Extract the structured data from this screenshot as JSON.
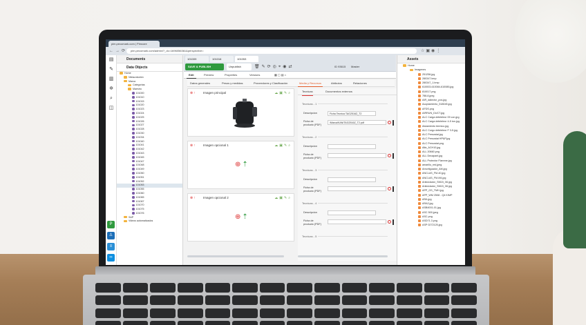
{
  "browser": {
    "tab_title": "pim.pecomark.com | Pimcore",
    "url": "pim.pecomark.com/admin/?_dc=1696056361&perspective="
  },
  "left_rail": {
    "icons": [
      "file-icon",
      "wrench-icon",
      "chart-icon",
      "gear-icon",
      "search-icon",
      "layers-icon"
    ]
  },
  "tree": {
    "documents_label": "Documents",
    "data_objects_label": "Data Objects",
    "items": [
      {
        "label": "Home",
        "type": "folder",
        "indent": 0
      },
      {
        "label": "Ntesuraturión",
        "type": "folder",
        "indent": 1
      },
      {
        "label": "Marca",
        "type": "folder",
        "indent": 1
      },
      {
        "label": "Categorías",
        "type": "folder",
        "indent": 2
      },
      {
        "label": "Maestro",
        "type": "folder",
        "indent": 2
      },
      {
        "label": "101000",
        "type": "object",
        "indent": 3
      },
      {
        "label": "101010",
        "type": "object",
        "indent": 3
      },
      {
        "label": "101015",
        "type": "object",
        "indent": 3
      },
      {
        "label": "101020",
        "type": "object",
        "indent": 3
      },
      {
        "label": "101023",
        "type": "object",
        "indent": 3
      },
      {
        "label": "101024",
        "type": "object",
        "indent": 3
      },
      {
        "label": "101025",
        "type": "object",
        "indent": 3
      },
      {
        "label": "101026",
        "type": "object",
        "indent": 3
      },
      {
        "label": "101027",
        "type": "object",
        "indent": 3
      },
      {
        "label": "101028",
        "type": "object",
        "indent": 3
      },
      {
        "label": "101030",
        "type": "object",
        "indent": 3
      },
      {
        "label": "101034",
        "type": "object",
        "indent": 3
      },
      {
        "label": "101040",
        "type": "object",
        "indent": 3
      },
      {
        "label": "101041",
        "type": "object",
        "indent": 3
      },
      {
        "label": "101042",
        "type": "object",
        "indent": 3
      },
      {
        "label": "101043",
        "type": "object",
        "indent": 3
      },
      {
        "label": "101045",
        "type": "object",
        "indent": 3
      },
      {
        "label": "101047",
        "type": "object",
        "indent": 3
      },
      {
        "label": "101048",
        "type": "object",
        "indent": 3
      },
      {
        "label": "101049",
        "type": "object",
        "indent": 3
      },
      {
        "label": "101050",
        "type": "object",
        "indent": 3
      },
      {
        "label": "101051",
        "type": "object",
        "indent": 3
      },
      {
        "label": "101052",
        "type": "object",
        "indent": 3
      },
      {
        "label": "101053",
        "type": "object",
        "indent": 3,
        "selected": true
      },
      {
        "label": "101055",
        "type": "object",
        "indent": 3
      },
      {
        "label": "101060",
        "type": "object",
        "indent": 3
      },
      {
        "label": "101065",
        "type": "object",
        "indent": 3
      },
      {
        "label": "101067",
        "type": "object",
        "indent": 3
      },
      {
        "label": "101070",
        "type": "object",
        "indent": 3
      },
      {
        "label": "101075",
        "type": "object",
        "indent": 3
      },
      {
        "label": "101076",
        "type": "object",
        "indent": 3
      },
      {
        "label": "SAP",
        "type": "folder",
        "indent": 1
      },
      {
        "label": "Videos automatizados",
        "type": "folder",
        "indent": 1
      }
    ]
  },
  "object_tabs": [
    {
      "label": "101009"
    },
    {
      "label": "101016"
    },
    {
      "label": "101053"
    }
  ],
  "actions": {
    "save_publish": "SAVE & PUBLISH",
    "unpublish": "Unpublish",
    "object_id": "ID 93615",
    "mode": "Master"
  },
  "subtabs": [
    "Edit",
    "Preview",
    "Properties",
    "Versions"
  ],
  "layout_tabs": [
    "Datos generales",
    "Pesos y medidas",
    "Proveedores y Clasificación",
    "Media y Recursos",
    "Atributos",
    "Relaciones"
  ],
  "images": [
    {
      "title": "Imagen principal"
    },
    {
      "title": "Imagen opcional 1"
    },
    {
      "title": "Imagen opcional 2"
    }
  ],
  "right_tabs": [
    "Tecnicas",
    "Documentos externos"
  ],
  "tecnicas": [
    {
      "title": "Tecnicas - 1",
      "description_label": "Descripcion",
      "description_value": "Ficha Tecnica TAG2516Z_T2",
      "file_label": "Ficha de producto (PDF)",
      "file_value": "/Marca/KAN/TAG2516Z_T2.pdf"
    },
    {
      "title": "Tecnicas - 2",
      "description_label": "Descripcion",
      "description_value": "",
      "file_label": "Ficha de producto (PDF)",
      "file_value": ""
    },
    {
      "title": "Tecnicas - 3",
      "description_label": "Descripcion",
      "description_value": "",
      "file_label": "Ficha de producto (PDF)",
      "file_value": ""
    },
    {
      "title": "Tecnicas - 4",
      "description_label": "Descripcion",
      "description_value": "",
      "file_label": "Ficha de producto (PDF)",
      "file_value": ""
    },
    {
      "title": "Tecnicas - 5"
    }
  ],
  "assets": {
    "title": "Assets",
    "root": "Home",
    "folder": "Imagenes",
    "items": [
      "251256.jpg",
      "280347.bmp",
      "280347_1.bmp",
      "610003-610084-610085.jpg",
      "810017.png",
      "788-8.jpeg",
      "AIR_dalector_pos.jpg",
      "Acoplamiento_518045.jpg",
      "AFDS.png",
      "AIRRUN_DUCT.jpg",
      "ALC Carga deteleleor 09 con.jpg",
      "ALC Carga deteleleor 4-5 ton.jpg",
      "Aislamiento termico.jpg",
      "ALC Corgo deteleleor F 3-5.jpg",
      "ALC Presostat.jpg",
      "ALC Presostat HP&P.jpg",
      "ALC Presostat.png",
      "Alfa_ACH10.jpg",
      "ALL 20660.png",
      "ALL Decapant.jpg",
      "ALL Protector Flamme.jpg",
      "amarillo_red.jpeg",
      "Amortiguador_AM.jpg",
      "ANCLAS_FM-40.jpg",
      "ANCLAS_FM-M4.jpg",
      "Anticiclador_SM15_08.jpg",
      "Anticiclador_SM15_08.jpg",
      "APP_GS_TMH.jpg",
      "APP_WM 2508 - Q4 KIMP",
      "ARA.jpg",
      "ARA2.jpg",
      "ASB4001-01.jpg",
      "ASC 500.jpeg",
      "ASC.png",
      "ASD71.3.png",
      "ASP 0272125.jpg"
    ]
  }
}
